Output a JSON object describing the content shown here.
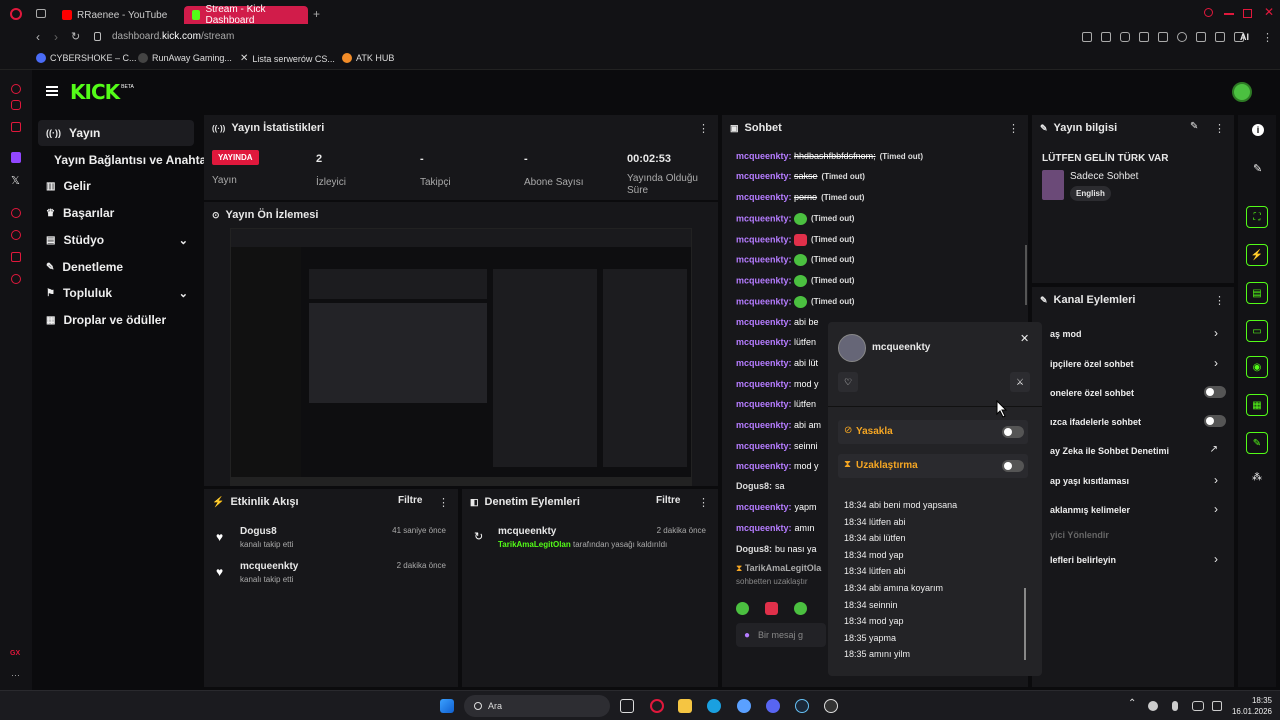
{
  "browser": {
    "tabs": [
      {
        "label": "RRaenee - YouTube"
      },
      {
        "label": "Stream - Kick Dashboard"
      }
    ],
    "url_prefix": "dashboard.",
    "url_domain": "kick.com",
    "url_path": "/stream",
    "bookmarks": [
      "CYBERSHOKE – C...",
      "RunAway Gaming...",
      "Lista serwerów CS...",
      "ATK HUB"
    ],
    "ai_label": "AI"
  },
  "kick": {
    "logo": "KICK",
    "beta": "BETA"
  },
  "nav": [
    {
      "label": "Yayın",
      "icon": "broadcast-icon"
    },
    {
      "label": "Yayın Bağlantısı ve Anahtarı",
      "icon": ""
    },
    {
      "label": "Gelir",
      "icon": "chart-icon"
    },
    {
      "label": "Başarılar",
      "icon": "trophy-icon"
    },
    {
      "label": "Stüdyo",
      "icon": "studio-icon"
    },
    {
      "label": "Denetleme",
      "icon": "wrench-icon"
    },
    {
      "label": "Topluluk",
      "icon": "community-icon"
    },
    {
      "label": "Droplar ve ödüller",
      "icon": "gift-icon"
    }
  ],
  "stats": {
    "title": "Yayın İstatistikleri",
    "live_badge": "YAYINDA",
    "status_label": "Yayın",
    "viewers": "2",
    "viewers_label": "İzleyici",
    "followers": "-",
    "followers_label": "Takipçi",
    "subs": "-",
    "subs_label": "Abone Sayısı",
    "duration": "00:02:53",
    "duration_label": "Yayında Olduğu Süre"
  },
  "preview": {
    "title": "Yayın Ön İzlemesi"
  },
  "activity": {
    "title": "Etkinlik Akışı",
    "filter": "Filtre",
    "items": [
      {
        "name": "Dogus8",
        "sub": "kanalı takip etti",
        "time": "41 saniye önce"
      },
      {
        "name": "mcqueenkty",
        "sub": "kanalı takip etti",
        "time": "2 dakika önce"
      }
    ]
  },
  "moderation": {
    "title": "Denetim Eylemleri",
    "filter": "Filtre",
    "items": [
      {
        "name": "mcqueenkty",
        "by": "TarikAmaLegitOlan",
        "sub": "tarafından yasağı kaldırıldı",
        "time": "2 dakika önce"
      }
    ]
  },
  "chat": {
    "title": "Sohbet",
    "lines": [
      {
        "user": "mcqueenkty",
        "msg": "hhdbashfbbfdsfnom;",
        "note": "(Timed out)"
      },
      {
        "user": "mcqueenkty",
        "msg": "sakse",
        "note": "(Timed out)"
      },
      {
        "user": "mcqueenkty",
        "msg": "porno",
        "note": "(Timed out)"
      },
      {
        "user": "mcqueenkty",
        "msg": "",
        "note": "(Timed out)"
      },
      {
        "user": "mcqueenkty",
        "msg": "",
        "note": "(Timed out)"
      },
      {
        "user": "mcqueenkty",
        "msg": "",
        "note": "(Timed out)"
      },
      {
        "user": "mcqueenkty",
        "msg": "",
        "note": "(Timed out)"
      },
      {
        "user": "mcqueenkty",
        "msg": "",
        "note": "(Timed out)"
      },
      {
        "user": "mcqueenkty",
        "msg": "abi be",
        "note": ""
      },
      {
        "user": "mcqueenkty",
        "msg": "lütfen",
        "note": ""
      },
      {
        "user": "mcqueenkty",
        "msg": "abi lüt",
        "note": ""
      },
      {
        "user": "mcqueenkty",
        "msg": "mod y",
        "note": ""
      },
      {
        "user": "mcqueenkty",
        "msg": "lütfen",
        "note": ""
      },
      {
        "user": "mcqueenkty",
        "msg": "abi am",
        "note": ""
      },
      {
        "user": "mcqueenkty",
        "msg": "seinni",
        "note": ""
      },
      {
        "user": "mcqueenkty",
        "msg": "mod y",
        "note": ""
      }
    ],
    "dogus_lines": [
      {
        "user": "Dogus8:",
        "msg": "sa"
      },
      {
        "user": "mcqueenkty:",
        "msg": "yapm"
      },
      {
        "user": "mcqueenkty:",
        "msg": "amın"
      },
      {
        "user": "Dogus8:",
        "msg": "bu nası ya"
      }
    ],
    "timeout_user": "TarikAmaLegitOla",
    "timeout_sub": "sohbetten uzaklaştır",
    "input_placeholder": "Bir mesaj g"
  },
  "popover": {
    "username": "mcqueenkty",
    "ban_label": "Yasakla",
    "timeout_label": "Uzaklaştırma",
    "log": [
      "18:34 abi beni mod yapsana",
      "18:34 lütfen abi",
      "18:34 abi lütfen",
      "18:34 mod yap",
      "18:34 lütfen abi",
      "18:34 abi amına koyarım",
      "18:34 seinnin",
      "18:34 mod yap",
      "18:35 yapma",
      "18:35 amını yilm"
    ]
  },
  "stream_info": {
    "title": "Yayın bilgisi",
    "stream_title": "LÜTFEN GELİN TÜRK VAR",
    "category": "Sadece Sohbet",
    "language": "English"
  },
  "channel_actions": {
    "title": "Kanal Eylemleri",
    "items": [
      {
        "label": "aş mod",
        "control": "chevron"
      },
      {
        "label": "ipçilere özel sohbet",
        "control": "chevron"
      },
      {
        "label": "onelere özel sohbet",
        "control": "toggle"
      },
      {
        "label": "ızca ifadelerle sohbet",
        "control": "toggle"
      },
      {
        "label": "ay Zeka ile Sohbet Denetimi",
        "control": "link"
      },
      {
        "label": "ap yaşı kısıtlaması",
        "control": "chevron"
      },
      {
        "label": "aklanmış kelimeler",
        "control": "chevron"
      },
      {
        "label": "yici Yönlendir",
        "control": "none"
      },
      {
        "label": "lefleri belirleyin",
        "control": "chevron"
      }
    ]
  },
  "taskbar": {
    "search": "Ara",
    "time": "18:35",
    "date": "16.01.2026"
  },
  "colors": {
    "accent": "#53fc18",
    "live": "#e0183c",
    "username": "#b57cff"
  }
}
